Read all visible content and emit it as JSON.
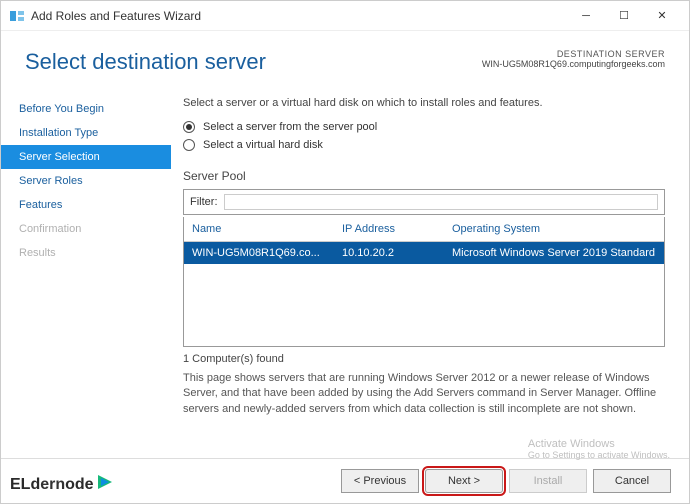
{
  "titlebar": {
    "text": "Add Roles and Features Wizard"
  },
  "header": {
    "title": "Select destination server",
    "dest_label": "DESTINATION SERVER",
    "dest_value": "WIN-UG5M08R1Q69.computingforgeeks.com"
  },
  "sidebar": {
    "items": [
      {
        "label": "Before You Begin",
        "state": "normal"
      },
      {
        "label": "Installation Type",
        "state": "normal"
      },
      {
        "label": "Server Selection",
        "state": "selected"
      },
      {
        "label": "Server Roles",
        "state": "normal"
      },
      {
        "label": "Features",
        "state": "normal"
      },
      {
        "label": "Confirmation",
        "state": "disabled"
      },
      {
        "label": "Results",
        "state": "disabled"
      }
    ]
  },
  "main": {
    "instruction": "Select a server or a virtual hard disk on which to install roles and features.",
    "radio1": "Select a server from the server pool",
    "radio2": "Select a virtual hard disk",
    "pool_label": "Server Pool",
    "filter_label": "Filter:",
    "filter_value": "",
    "table": {
      "headers": {
        "name": "Name",
        "ip": "IP Address",
        "os": "Operating System"
      },
      "rows": [
        {
          "name": "WIN-UG5M08R1Q69.co...",
          "ip": "10.10.20.2",
          "os": "Microsoft Windows Server 2019 Standard"
        }
      ]
    },
    "count": "1 Computer(s) found",
    "description": "This page shows servers that are running Windows Server 2012 or a newer release of Windows Server, and that have been added by using the Add Servers command in Server Manager. Offline servers and newly-added servers from which data collection is still incomplete are not shown."
  },
  "footer": {
    "previous": "< Previous",
    "next": "Next >",
    "install": "Install",
    "cancel": "Cancel"
  },
  "watermark": {
    "line1": "Activate Windows",
    "line2": "Go to Settings to activate Windows."
  },
  "logo": {
    "text1": "ELd",
    "text2": "ern",
    "text3": "ode"
  }
}
